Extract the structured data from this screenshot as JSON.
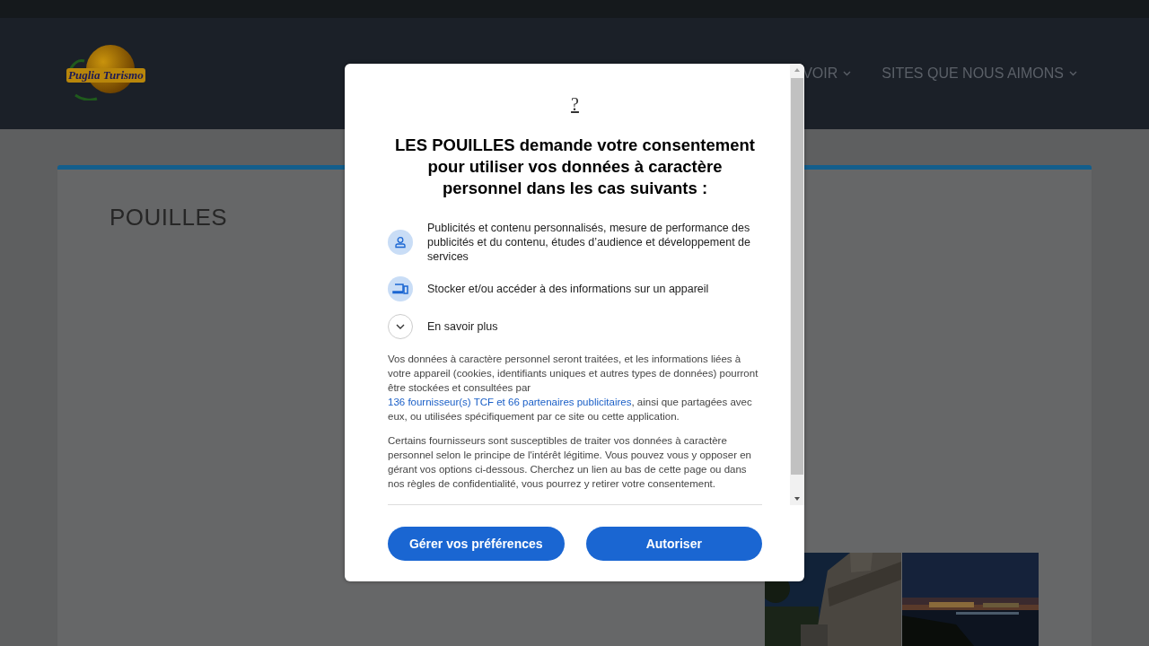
{
  "header": {
    "logo_text": "Puglia Turismo",
    "nav": [
      {
        "label": "VOIR",
        "has_submenu": true
      },
      {
        "label": "SITES QUE NOUS AIMONS",
        "has_submenu": true
      }
    ]
  },
  "page": {
    "title": "POUILLES"
  },
  "consent": {
    "help_link": "?",
    "heading": "LES POUILLES demande votre consentement pour utiliser vos données à caractère personnel dans les cas suivants :",
    "purposes": [
      {
        "kind": "personalisation",
        "text": "Publicités et contenu personnalisés, mesure de performance des publicités et du contenu, études d’audience et développement de services"
      },
      {
        "kind": "storage",
        "text": "Stocker et/ou accéder à des informations sur un appareil"
      }
    ],
    "more": {
      "label": "En savoir plus",
      "expanded": false
    },
    "paragraphs": [
      {
        "before": "Vos données à caractère personnel seront traitées, et les informations liées à votre appareil (cookies, identifiants uniques et autres types de données) pourront être stockées et consultées par ",
        "link": "136 fournisseur(s) TCF et 66 partenaires publicitaires",
        "after": ", ainsi que partagées avec eux, ou utilisées spécifiquement par ce site ou cette application."
      },
      {
        "before": "Certains fournisseurs sont susceptibles de traiter vos données à caractère personnel selon le principe de l'intérêt légitime. Vous pouvez vous y opposer en gérant vos options ci-dessous. Cherchez un lien au bas de cette page ou dans nos règles de confidentialité, vous pourrez y retirer votre consentement."
      }
    ],
    "buttons": [
      "Gérer vos préférences",
      "Autoriser"
    ]
  }
}
